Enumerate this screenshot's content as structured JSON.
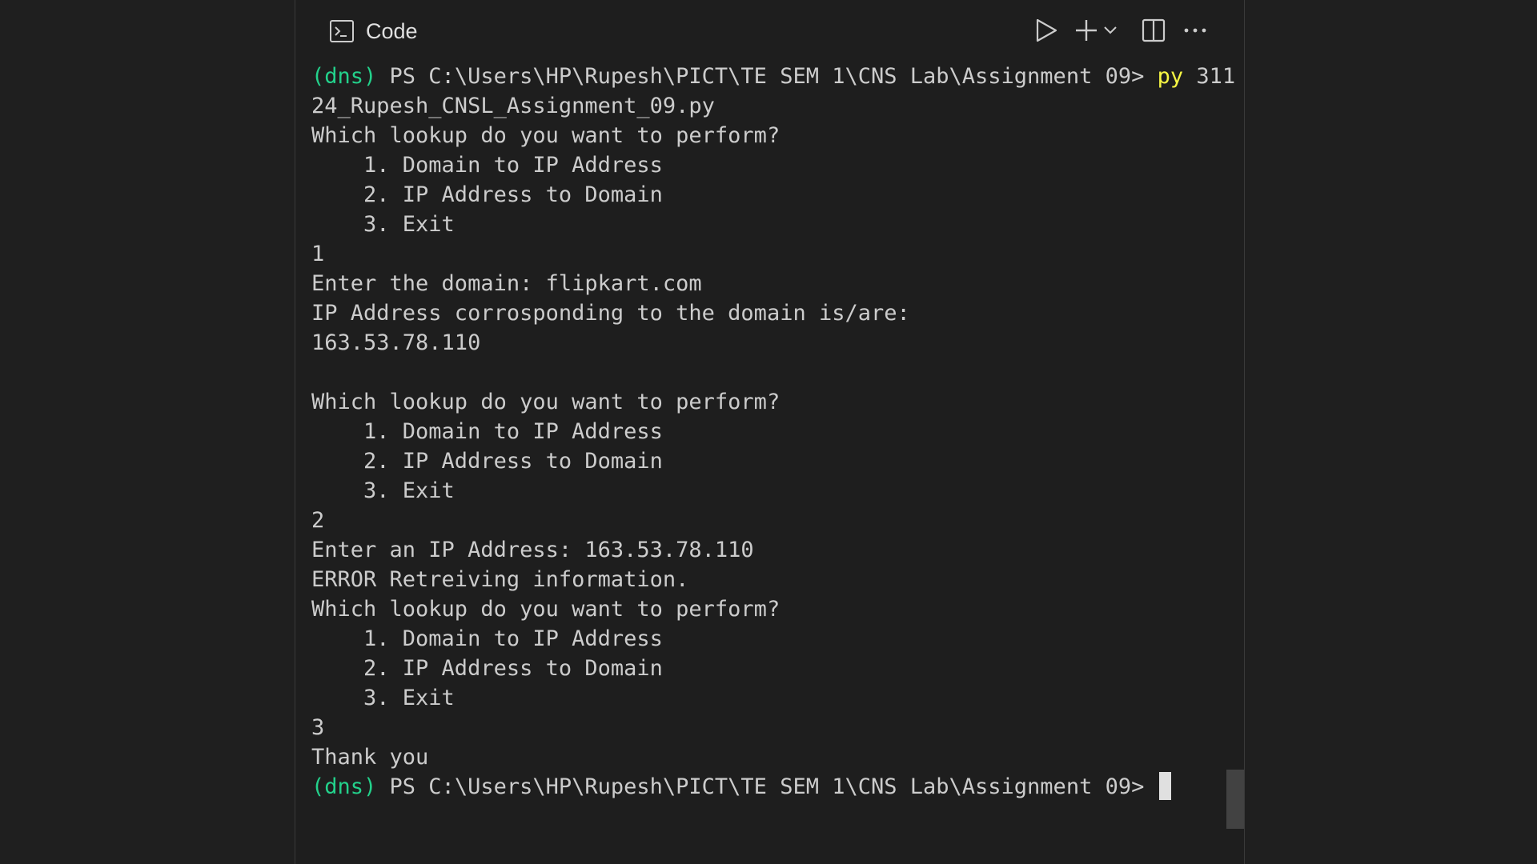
{
  "header": {
    "title": "Code",
    "icons": {
      "terminal": "terminal-icon",
      "run": "play-icon",
      "new": "plus-icon",
      "new_dropdown": "chevron-down-icon",
      "split": "split-editor-icon",
      "more": "more-icon"
    }
  },
  "terminal": {
    "env": "(dns)",
    "prompt": " PS C:\\Users\\HP\\Rupesh\\PICT\\TE SEM 1\\CNS Lab\\Assignment 09> ",
    "command_keyword": "py",
    "command_args_1": " 311",
    "command_args_2": "24_Rupesh_CNSL_Assignment_09.py",
    "lines": [
      "Which lookup do you want to perform?",
      "    1. Domain to IP Address",
      "    2. IP Address to Domain",
      "    3. Exit",
      "1",
      "Enter the domain: flipkart.com",
      "IP Address corrosponding to the domain is/are:",
      "163.53.78.110",
      "",
      "Which lookup do you want to perform?",
      "    1. Domain to IP Address",
      "    2. IP Address to Domain",
      "    3. Exit",
      "2",
      "Enter an IP Address: 163.53.78.110",
      "ERROR Retreiving information.",
      "Which lookup do you want to perform?",
      "    1. Domain to IP Address",
      "    2. IP Address to Domain",
      "    3. Exit",
      "3",
      "Thank you"
    ],
    "final_env": "(dns)",
    "final_prompt": " PS C:\\Users\\HP\\Rupesh\\PICT\\TE SEM 1\\CNS Lab\\Assignment 09> "
  },
  "colors": {
    "background": "#1e1e1e",
    "text": "#cccccc",
    "env": "#23d18b",
    "command": "#f5f543"
  }
}
